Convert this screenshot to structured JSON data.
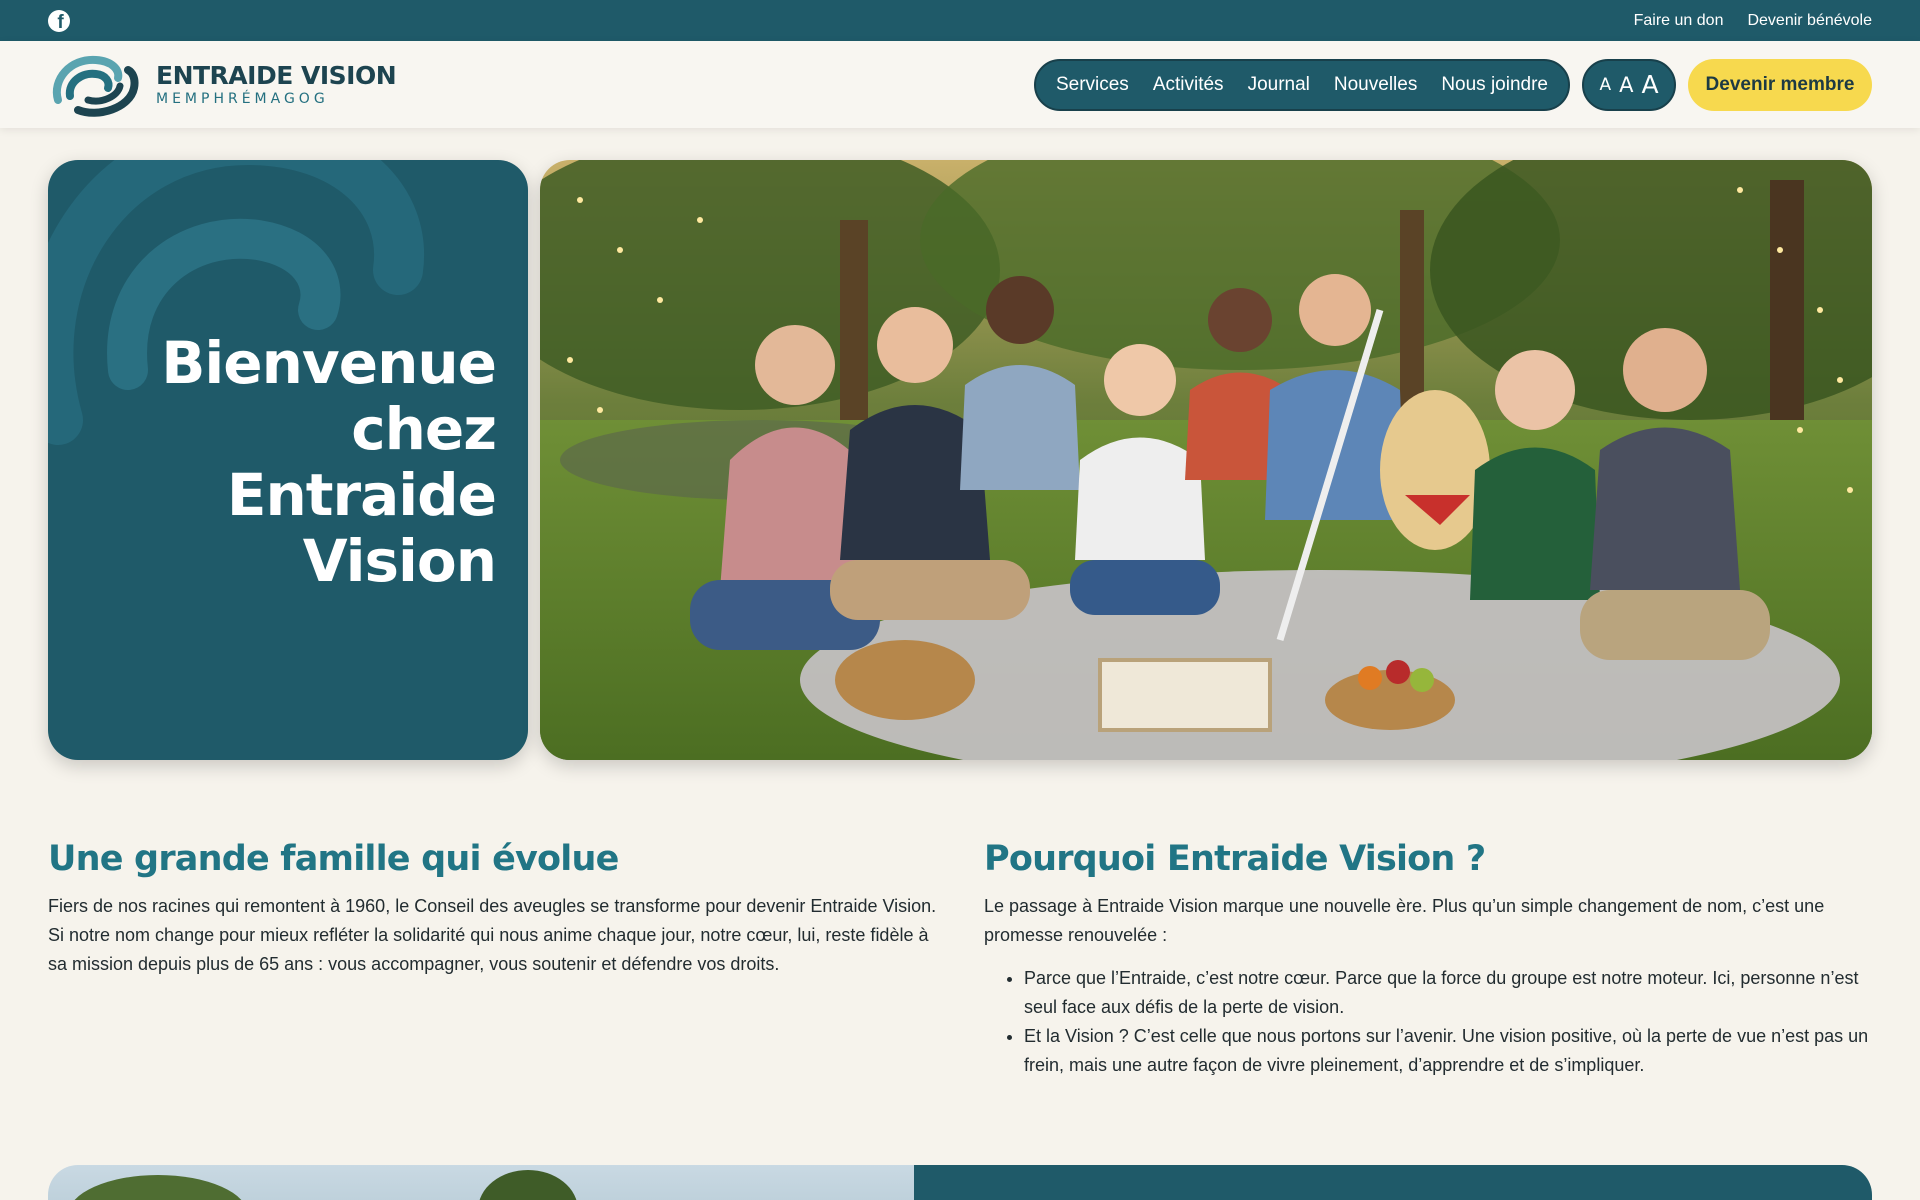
{
  "topbar": {
    "facebook_icon": "facebook-icon",
    "links": [
      "Faire un don",
      "Devenir bénévole"
    ]
  },
  "header": {
    "logo_title": "ENTRAIDE VISION",
    "logo_subtitle": "MEMPHRÉMAGOG",
    "nav": [
      "Services",
      "Activités",
      "Journal",
      "Nouvelles",
      "Nous joindre"
    ],
    "font_size_controls": [
      "A",
      "A",
      "A"
    ],
    "cta_label": "Devenir membre"
  },
  "hero": {
    "title": "Bienvenue chez Entraide Vision",
    "photo_icon": "community-picnic-photo"
  },
  "sections": {
    "left": {
      "heading": "Une grande famille qui évolue",
      "body": "Fiers de nos racines qui remontent à 1960, le Conseil des aveugles se transforme pour devenir Entraide Vision. Si notre nom change pour mieux refléter la solidarité qui nous anime chaque jour, notre cœur, lui, reste fidèle à sa mission depuis plus de 65 ans : vous accompagner, vous soutenir et défendre vos droits."
    },
    "right": {
      "heading": "Pourquoi Entraide Vision ?",
      "intro": "Le passage à Entraide Vision marque une nouvelle ère. Plus qu’un simple changement de nom, c’est une promesse renouvelée :",
      "bullets": [
        "Parce que l’Entraide, c’est notre cœur. Parce que la force du groupe est notre moteur. Ici, personne n’est seul face aux défis de la perte de vision.",
        "Et la Vision ? C’est celle que nous portons sur l’avenir. Une vision positive, où la perte de vue n’est pas un frein, mais une autre façon de vivre pleinement, d’apprendre et de s’impliquer."
      ]
    }
  },
  "colors": {
    "primary": "#1f5a69",
    "heading": "#217585",
    "accent": "#f7d94e",
    "background": "#f6f3ec"
  }
}
